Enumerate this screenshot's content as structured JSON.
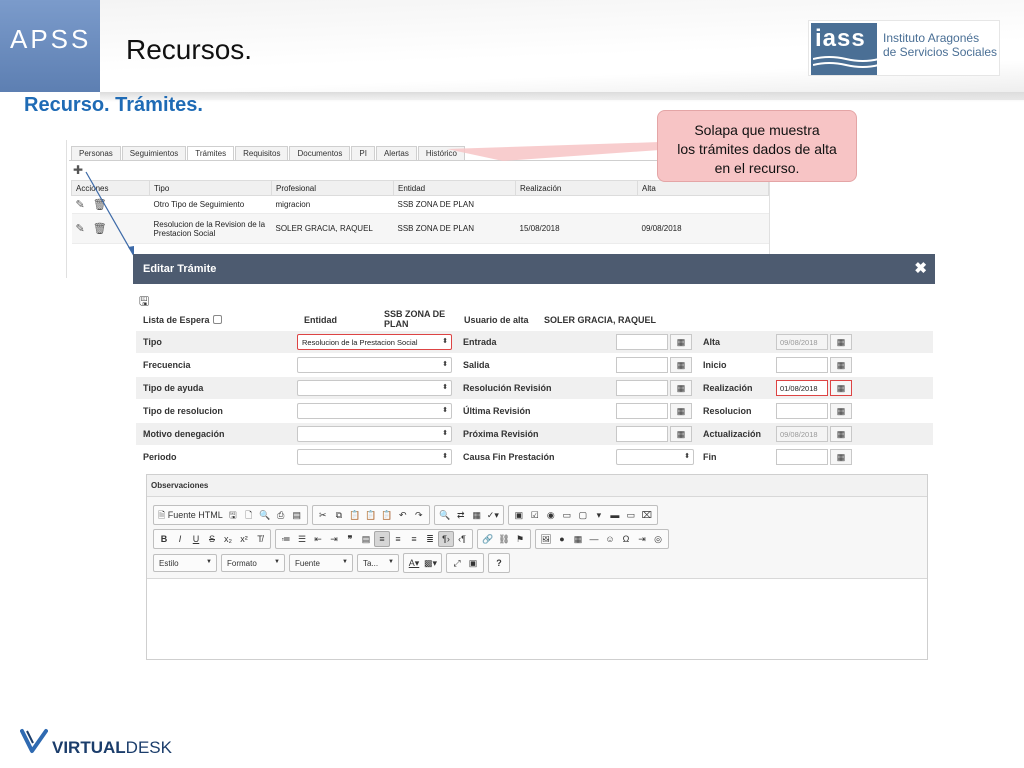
{
  "slide": {
    "brand": "APSS",
    "title": "Recursos.",
    "subtitle": "Recurso. Trámites.",
    "logo": {
      "mark": "iass",
      "line1": "Instituto Aragonés",
      "line2": "de Servicios Sociales"
    },
    "callout": {
      "line1": "Solapa que muestra",
      "line2": "los  trámites dados de alta",
      "line3": "en  el recurso."
    },
    "footer_logo_bold": "VIRTUAL",
    "footer_logo_thin": "DESK"
  },
  "background_screen": {
    "tabs": [
      "Personas",
      "Seguimientos",
      "Trámites",
      "Requisitos",
      "Documentos",
      "PI",
      "Alertas",
      "Histórico"
    ],
    "add_icon": "plus-icon",
    "columns": [
      "Acciones",
      "Tipo",
      "Profesional",
      "Entidad",
      "Realización",
      "Alta"
    ],
    "rows": [
      {
        "tipo": "Otro Tipo de Seguimiento",
        "profesional": "migracion",
        "entidad": "SSB ZONA DE PLAN",
        "realizacion": "",
        "alta": ""
      },
      {
        "tipo": "Resolucion de la Revision de la Prestacion Social",
        "profesional": "SOLER GRACIA, RAQUEL",
        "entidad": "SSB ZONA DE PLAN",
        "realizacion": "15/08/2018",
        "alta": "09/08/2018"
      }
    ]
  },
  "modal": {
    "title": "Editar Trámite",
    "close": "✖",
    "lista_espera_label": "Lista de Espera",
    "entidad_label": "Entidad",
    "entidad_value_1": "SSB ZONA DE",
    "entidad_value_2": "PLAN",
    "usuario_alta_label": "Usuario de alta",
    "usuario_alta_value": "SOLER GRACIA, RAQUEL",
    "left_labels": [
      "Tipo",
      "Frecuencia",
      "Tipo de ayuda",
      "Tipo de resolucion",
      "Motivo denegación",
      "Periodo"
    ],
    "tipo_selected": "Resolucion de la Prestacion Social",
    "mid_labels": [
      "Entrada",
      "Salida",
      "Resolución Revisión",
      "Última Revisión",
      "Próxima Revisión",
      "Causa Fin Prestación"
    ],
    "right_labels": [
      "Alta",
      "Inicio",
      "Realización",
      "Resolucion",
      "Actualización",
      "Fin"
    ],
    "right_values": [
      "09/08/2018",
      "",
      "01/08/2018",
      "",
      "09/08/2018",
      ""
    ],
    "observaciones_label": "Observaciones",
    "editor": {
      "source_label": "Fuente HTML",
      "estilo": "Estilo",
      "formato": "Formato",
      "fuente": "Fuente",
      "tamano": "Ta...",
      "help": "?"
    }
  }
}
